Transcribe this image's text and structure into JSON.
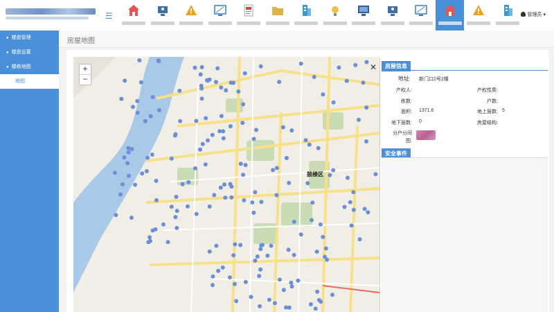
{
  "header": {
    "user_label": "管理员",
    "nav_items": [
      {
        "icon": "house-icon",
        "color": "#e55353"
      },
      {
        "icon": "monitor-person-icon",
        "color": "#3d6ea8"
      },
      {
        "icon": "warning-icon",
        "color": "#f0a020"
      },
      {
        "icon": "screen-icon",
        "color": "#3a7ec0"
      },
      {
        "icon": "document-icon",
        "color": "#d04545"
      },
      {
        "icon": "folder-icon",
        "color": "#e0b24a"
      },
      {
        "icon": "building-icon",
        "color": "#3a98d0"
      },
      {
        "icon": "bulb-icon",
        "color": "#f0c040"
      },
      {
        "icon": "monitor-icon",
        "color": "#2f5f9a"
      },
      {
        "icon": "monitor-person-icon",
        "color": "#3d6ea8"
      },
      {
        "icon": "screen-icon",
        "color": "#3a7ec0"
      },
      {
        "icon": "house-icon",
        "color": "#e55353"
      },
      {
        "icon": "warning-icon",
        "color": "#f0a020"
      },
      {
        "icon": "building-icon",
        "color": "#3a98d0"
      }
    ],
    "active_index": 11
  },
  "sidebar": {
    "items": [
      {
        "label": "楼盘管理"
      },
      {
        "label": "楼盘设置"
      },
      {
        "label": "楼栋地图"
      }
    ],
    "sub_item": "地图"
  },
  "page_title": "房屋地图",
  "map": {
    "zoom_in": "+",
    "zoom_out": "−",
    "district": "鼓楼区"
  },
  "panel": {
    "close": "✕",
    "house_info_title": "房屋信息",
    "address_label": "地址:",
    "address_value": "新门口2号2幢",
    "owner_label": "产权人:",
    "property_nature_label": "产权性质:",
    "buildings_label": "栋数:",
    "households_label": "户数:",
    "area_label": "面积:",
    "area_value": "1371.6",
    "floors_above_label": "地上层数:",
    "floors_above_value": "5",
    "floors_below_label": "地下层数:",
    "floors_below_value": "0",
    "structure_label": "房屋结构:",
    "floorplan_label_1": "分户分间",
    "floorplan_label_2": "图:",
    "safety_title": "安全事件"
  },
  "colors": {
    "accent": "#4a90d9",
    "marker": "#6b8fd6",
    "river": "#a9c9e8"
  }
}
